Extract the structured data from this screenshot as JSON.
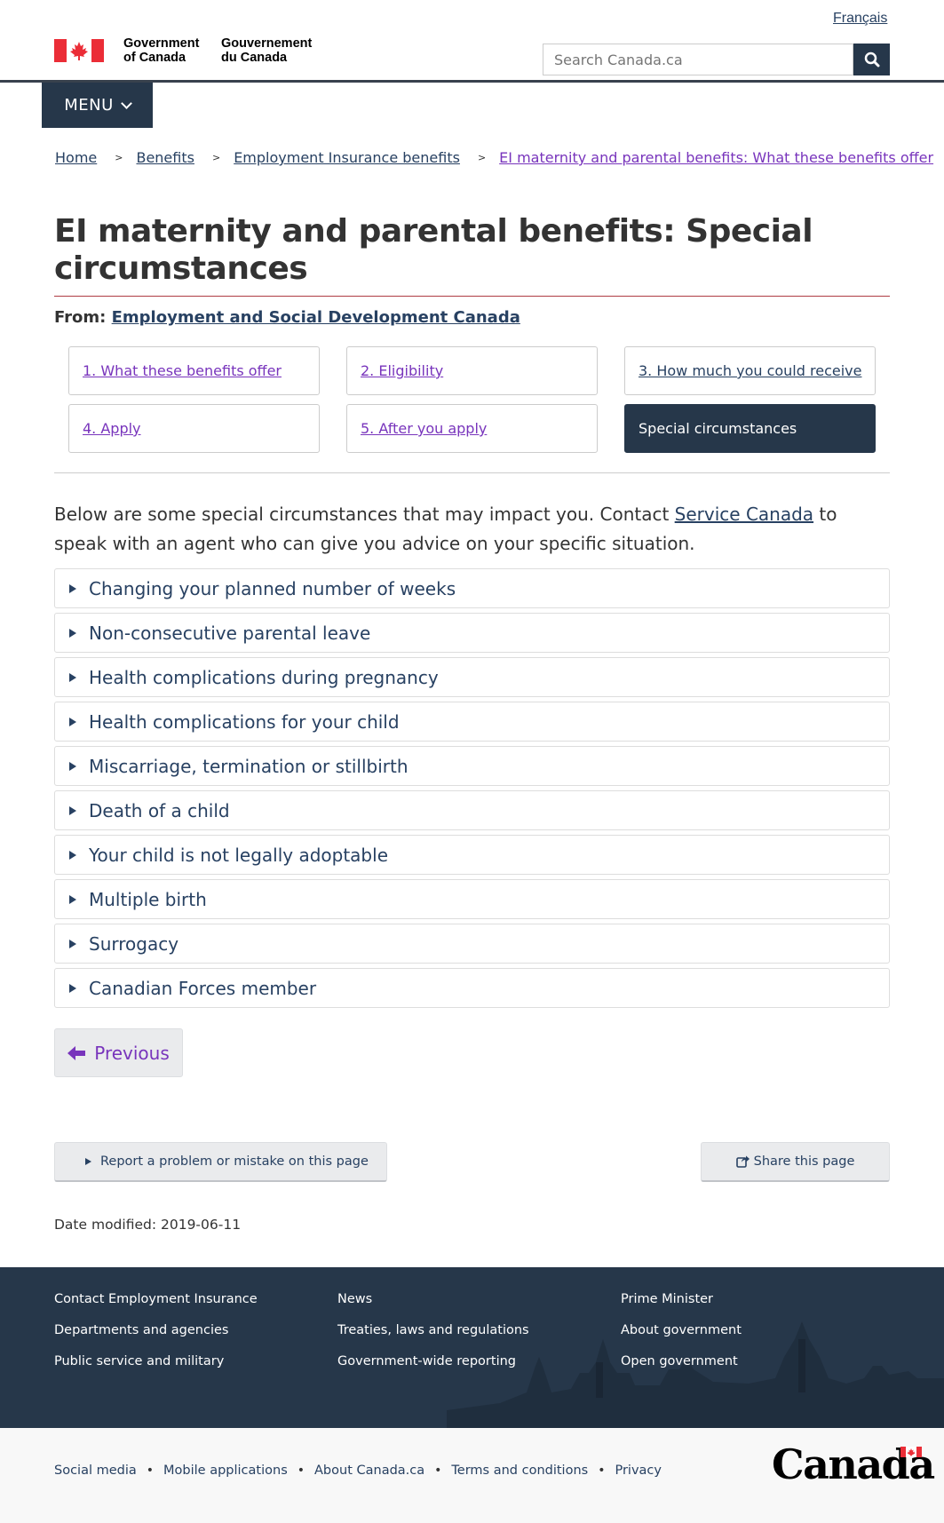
{
  "header": {
    "language_toggle": "Français",
    "gov_en_line1": "Government",
    "gov_en_line2": "of Canada",
    "gov_fr_line1": "Gouvernement",
    "gov_fr_line2": "du Canada",
    "search_placeholder": "Search Canada.ca",
    "menu_label": "MENU"
  },
  "breadcrumb": [
    "Home",
    "Benefits",
    "Employment Insurance benefits",
    "EI maternity and parental benefits: What these benefits offer"
  ],
  "page": {
    "title": "EI maternity and parental benefits: Special circumstances",
    "from_label": "From:",
    "from_link": "Employment and Social Development Canada"
  },
  "steps": [
    {
      "label": "1. What these benefits offer"
    },
    {
      "label": "2. Eligibility"
    },
    {
      "label": "3. How much you could receive"
    },
    {
      "label": "4. Apply"
    },
    {
      "label": "5. After you apply"
    },
    {
      "label": "Special circumstances"
    }
  ],
  "intro": {
    "before": "Below are some special circumstances that may impact you. Contact ",
    "link": "Service Canada",
    "after": " to speak with an agent who can give you advice on your specific situation."
  },
  "details": [
    "Changing your planned number of weeks",
    "Non-consecutive parental leave",
    "Health complications during pregnancy",
    "Health complications for your child",
    "Miscarriage, termination or stillbirth",
    "Death of a child",
    "Your child is not legally adoptable",
    "Multiple birth",
    "Surrogacy",
    "Canadian Forces member"
  ],
  "pager": {
    "previous": "Previous"
  },
  "feedback": {
    "report": "Report a problem or mistake on this page",
    "share": "Share this page"
  },
  "modified": "Date modified: 2019-06-11",
  "footer": {
    "col1": [
      "Contact Employment Insurance",
      "Departments and agencies",
      "Public service and military"
    ],
    "col2": [
      "News",
      "Treaties, laws and regulations",
      "Government-wide reporting"
    ],
    "col3": [
      "Prime Minister",
      "About government",
      "Open government"
    ],
    "sub_links": [
      "Social media",
      "Mobile applications",
      "About Canada.ca",
      "Terms and conditions",
      "Privacy"
    ],
    "wordmark": "Canada"
  },
  "colors": {
    "brand_dark": "#26374a",
    "link": "#284162",
    "visited_link": "#7834bc",
    "title_rule": "#af3c43",
    "flag_red": "#eb2d37"
  }
}
